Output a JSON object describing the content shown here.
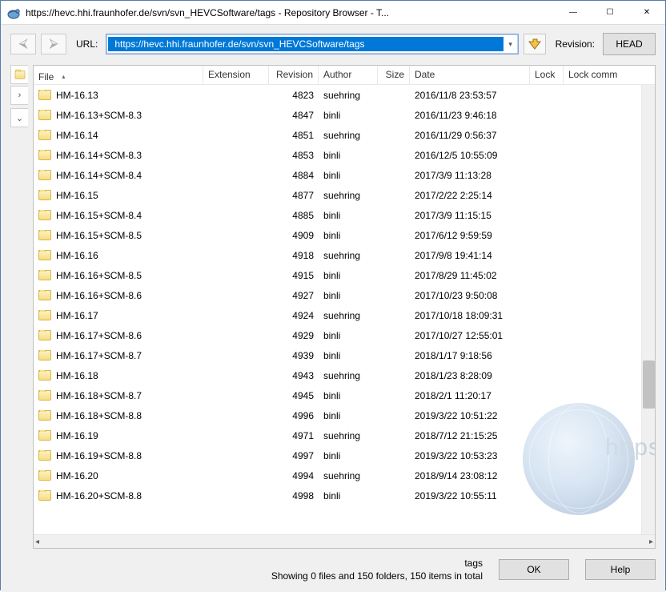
{
  "window": {
    "title": "https://hevc.hhi.fraunhofer.de/svn/svn_HEVCSoftware/tags - Repository Browser - T...",
    "min_icon": "—",
    "max_icon": "☐",
    "close_icon": "✕"
  },
  "toolbar": {
    "url_label": "URL:",
    "url_value": "https://hevc.hhi.fraunhofer.de/svn/svn_HEVCSoftware/tags",
    "revision_label": "Revision:",
    "head_label": "HEAD"
  },
  "columns": {
    "file": "File",
    "extension": "Extension",
    "revision": "Revision",
    "author": "Author",
    "size": "Size",
    "date": "Date",
    "lock": "Lock",
    "lock_comment": "Lock comm"
  },
  "rows": [
    {
      "file": "HM-16.13",
      "rev": "4823",
      "author": "suehring",
      "date": "2016/11/8 23:53:57"
    },
    {
      "file": "HM-16.13+SCM-8.3",
      "rev": "4847",
      "author": "binli",
      "date": "2016/11/23 9:46:18"
    },
    {
      "file": "HM-16.14",
      "rev": "4851",
      "author": "suehring",
      "date": "2016/11/29 0:56:37"
    },
    {
      "file": "HM-16.14+SCM-8.3",
      "rev": "4853",
      "author": "binli",
      "date": "2016/12/5 10:55:09"
    },
    {
      "file": "HM-16.14+SCM-8.4",
      "rev": "4884",
      "author": "binli",
      "date": "2017/3/9 11:13:28"
    },
    {
      "file": "HM-16.15",
      "rev": "4877",
      "author": "suehring",
      "date": "2017/2/22 2:25:14"
    },
    {
      "file": "HM-16.15+SCM-8.4",
      "rev": "4885",
      "author": "binli",
      "date": "2017/3/9 11:15:15"
    },
    {
      "file": "HM-16.15+SCM-8.5",
      "rev": "4909",
      "author": "binli",
      "date": "2017/6/12 9:59:59"
    },
    {
      "file": "HM-16.16",
      "rev": "4918",
      "author": "suehring",
      "date": "2017/9/8 19:41:14"
    },
    {
      "file": "HM-16.16+SCM-8.5",
      "rev": "4915",
      "author": "binli",
      "date": "2017/8/29 11:45:02"
    },
    {
      "file": "HM-16.16+SCM-8.6",
      "rev": "4927",
      "author": "binli",
      "date": "2017/10/23 9:50:08"
    },
    {
      "file": "HM-16.17",
      "rev": "4924",
      "author": "suehring",
      "date": "2017/10/18 18:09:31"
    },
    {
      "file": "HM-16.17+SCM-8.6",
      "rev": "4929",
      "author": "binli",
      "date": "2017/10/27 12:55:01"
    },
    {
      "file": "HM-16.17+SCM-8.7",
      "rev": "4939",
      "author": "binli",
      "date": "2018/1/17 9:18:56"
    },
    {
      "file": "HM-16.18",
      "rev": "4943",
      "author": "suehring",
      "date": "2018/1/23 8:28:09"
    },
    {
      "file": "HM-16.18+SCM-8.7",
      "rev": "4945",
      "author": "binli",
      "date": "2018/2/1 11:20:17"
    },
    {
      "file": "HM-16.18+SCM-8.8",
      "rev": "4996",
      "author": "binli",
      "date": "2019/3/22 10:51:22"
    },
    {
      "file": "HM-16.19",
      "rev": "4971",
      "author": "suehring",
      "date": "2018/7/12 21:15:25"
    },
    {
      "file": "HM-16.19+SCM-8.8",
      "rev": "4997",
      "author": "binli",
      "date": "2019/3/22 10:53:23"
    },
    {
      "file": "HM-16.20",
      "rev": "4994",
      "author": "suehring",
      "date": "2018/9/14 23:08:12"
    },
    {
      "file": "HM-16.20+SCM-8.8",
      "rev": "4998",
      "author": "binli",
      "date": "2019/3/22 10:55:11"
    }
  ],
  "footer": {
    "path": "tags",
    "summary": "Showing 0 files and 150 folders, 150 items in total",
    "ok": "OK",
    "help": "Help"
  },
  "watermark_text": "https"
}
